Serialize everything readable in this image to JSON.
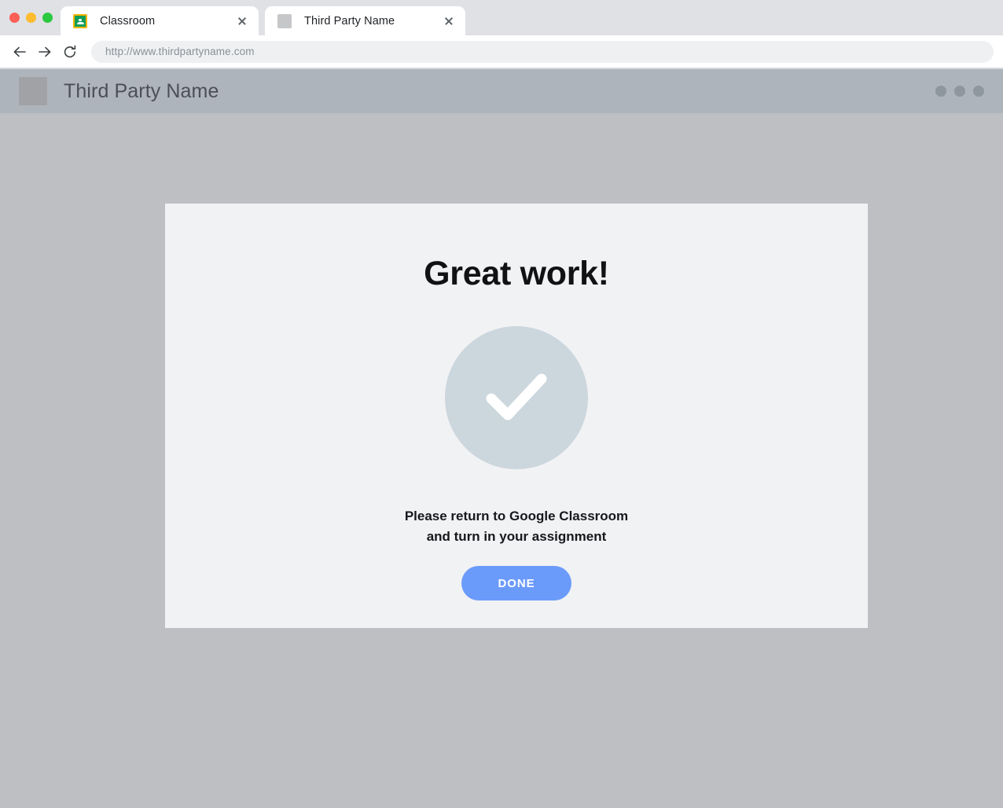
{
  "browser": {
    "window_controls": [
      {
        "name": "close",
        "color": "#fc5f57"
      },
      {
        "name": "minimize",
        "color": "#fdbc2f"
      },
      {
        "name": "maximize",
        "color": "#2bc940"
      }
    ],
    "tabs": [
      {
        "title": "Classroom",
        "favicon": "google-classroom-icon",
        "active": false,
        "close_label": "×"
      },
      {
        "title": "Third Party Name",
        "favicon": "placeholder-square-icon",
        "active": true,
        "close_label": "×"
      }
    ],
    "toolbar": {
      "back_icon": "arrow-left-icon",
      "forward_icon": "arrow-right-icon",
      "reload_icon": "reload-icon",
      "url": "http://www.thirdpartyname.com"
    }
  },
  "site": {
    "header": {
      "logo": "placeholder-logo-icon",
      "title": "Third Party Name",
      "menu_icon": "three-dots-icon",
      "menu_dot_count": 3,
      "background_color": "#aeb4bc"
    },
    "background_color": "#bdbfc2"
  },
  "card": {
    "background_color": "#f1f2f4",
    "title": "Great work!",
    "check_icon": "checkmark-icon",
    "check_circle_color": "#ccd6dd",
    "check_mark_color": "#ffffff",
    "message_line_1": "Please return to Google Classroom",
    "message_line_2": "and turn in your assignment",
    "done_label": "DONE",
    "done_color": "#6b9bfa"
  }
}
